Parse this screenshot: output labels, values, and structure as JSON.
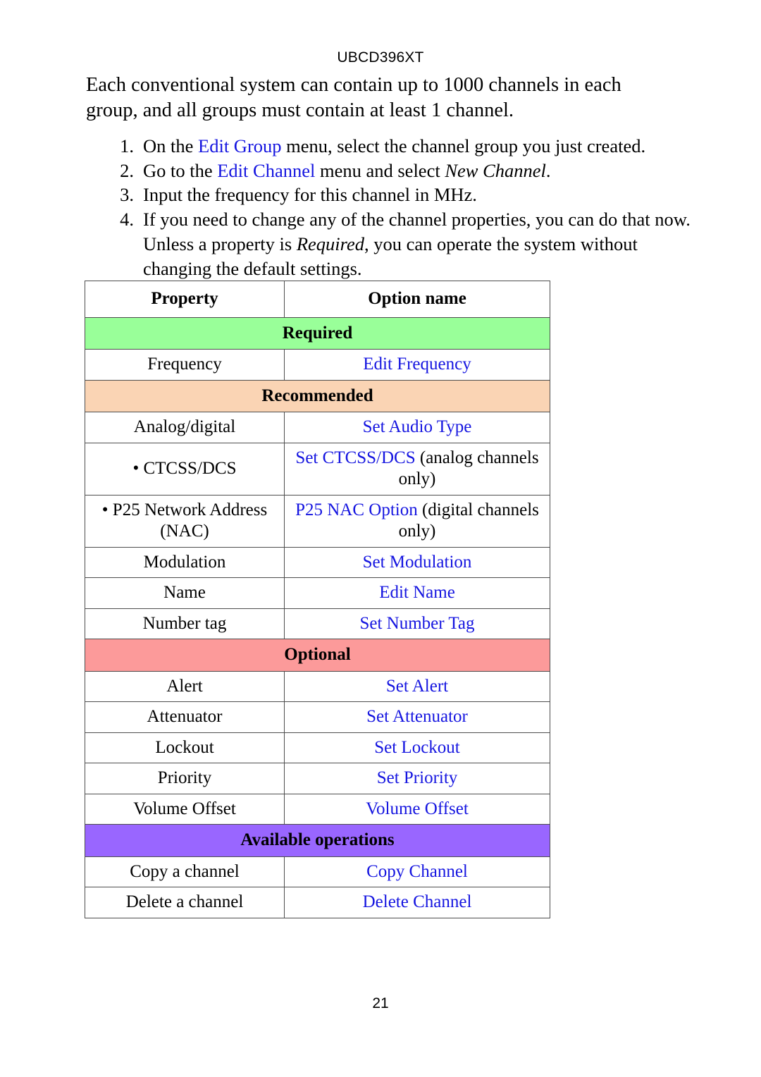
{
  "header": {
    "model": "UBCD396XT"
  },
  "intro": {
    "paragraph": "Each conventional system can contain up to 1000 channels in each group, and all groups must contain at least 1 channel."
  },
  "steps": [
    {
      "number": "1.",
      "parts": [
        {
          "text": "On the ",
          "style": "plain"
        },
        {
          "text": "Edit Group",
          "style": "link"
        },
        {
          "text": " menu, select the channel group you just created.",
          "style": "plain"
        }
      ]
    },
    {
      "number": "2.",
      "parts": [
        {
          "text": "Go to the ",
          "style": "plain"
        },
        {
          "text": "Edit Channel",
          "style": "link"
        },
        {
          "text": " menu and select ",
          "style": "plain"
        },
        {
          "text": "New Channel",
          "style": "italic"
        },
        {
          "text": ".",
          "style": "plain"
        }
      ]
    },
    {
      "number": "3.",
      "parts": [
        {
          "text": "Input the frequency for this channel in MHz.",
          "style": "plain"
        }
      ]
    },
    {
      "number": "4.",
      "parts": [
        {
          "text": "If you need to change any of the channel properties, you can do that now. Unless a property is ",
          "style": "plain"
        },
        {
          "text": "Required",
          "style": "italic"
        },
        {
          "text": ", you can operate the system without changing the default settings.",
          "style": "plain"
        }
      ]
    }
  ],
  "table": {
    "columns": {
      "property": "Property",
      "option_name": "Option name"
    },
    "sections": [
      {
        "band": "Required",
        "band_color": "#99ff99",
        "rows": [
          {
            "property": "Frequency",
            "option_link": "Edit Frequency",
            "option_note": ""
          }
        ]
      },
      {
        "band": "Recommended",
        "band_color": "#fad4b4",
        "rows": [
          {
            "property": "Analog/digital",
            "option_link": "Set Audio Type",
            "option_note": ""
          },
          {
            "property": "• CTCSS/DCS",
            "option_link": "Set CTCSS/DCS",
            "option_note": " (analog channels only)"
          },
          {
            "property": "• P25 Network Address (NAC)",
            "option_link": "P25 NAC Option",
            "option_note": " (digital channels only)"
          },
          {
            "property": "Modulation",
            "option_link": "Set Modulation",
            "option_note": ""
          },
          {
            "property": "Name",
            "option_link": "Edit Name",
            "option_note": ""
          },
          {
            "property": "Number tag",
            "option_link": "Set Number Tag",
            "option_note": ""
          }
        ]
      },
      {
        "band": "Optional",
        "band_color": "#fc9a9a",
        "rows": [
          {
            "property": "Alert",
            "option_link": "Set Alert",
            "option_note": ""
          },
          {
            "property": "Attenuator",
            "option_link": "Set Attenuator",
            "option_note": ""
          },
          {
            "property": "Lockout",
            "option_link": "Set Lockout",
            "option_note": ""
          },
          {
            "property": "Priority",
            "option_link": "Set Priority",
            "option_note": ""
          },
          {
            "property": "Volume Offset",
            "option_link": "Volume Offset",
            "option_note": ""
          }
        ]
      },
      {
        "band": "Available operations",
        "band_color": "#9966ff",
        "rows": [
          {
            "property": "Copy a channel",
            "option_link": "Copy Channel",
            "option_note": ""
          },
          {
            "property": "Delete a channel",
            "option_link": "Delete Channel",
            "option_note": ""
          }
        ]
      }
    ]
  },
  "footer": {
    "page_number": "21"
  },
  "colors": {
    "link_blue": "#1515e0",
    "band_required": "#99ff99",
    "band_recommended": "#fad4b4",
    "band_optional": "#fc9a9a",
    "band_operations": "#9966ff",
    "border": "#4d4d4d"
  }
}
